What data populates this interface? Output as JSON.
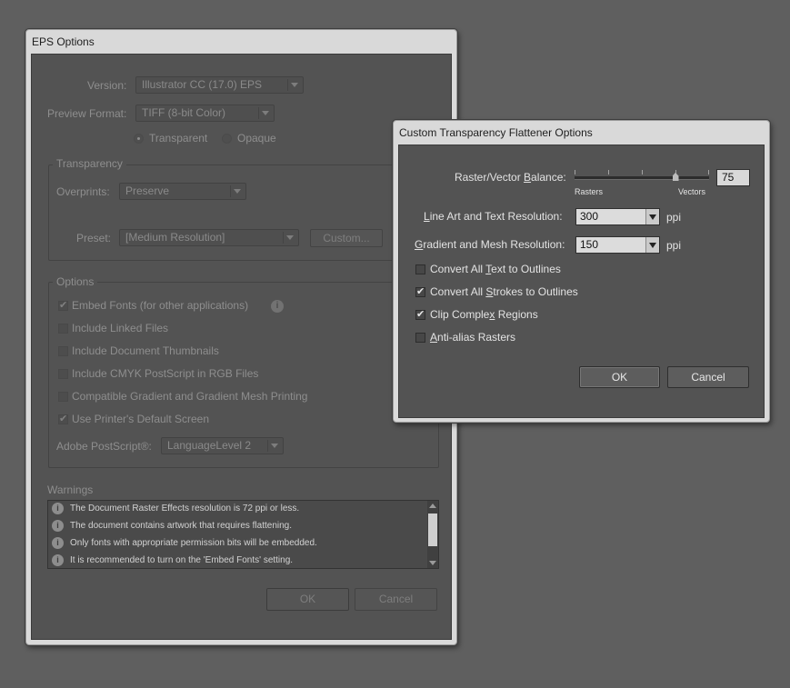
{
  "eps_dialog": {
    "title": "EPS Options",
    "version_label": "Version:",
    "version_value": "Illustrator CC (17.0) EPS",
    "preview_format_label": "Preview Format:",
    "preview_format_value": "TIFF (8-bit Color)",
    "radio_transparent": "Transparent",
    "radio_opaque": "Opaque",
    "transparency_group": "Transparency",
    "overprints_label": "Overprints:",
    "overprints_value": "Preserve",
    "preset_label": "Preset:",
    "preset_value": "[Medium Resolution]",
    "custom_button": "Custom...",
    "options_group": "Options",
    "checkboxes": [
      {
        "label": "Embed Fonts (for other applications)",
        "checked": true
      },
      {
        "label": "Include Linked Files",
        "checked": false
      },
      {
        "label": "Include Document Thumbnails",
        "checked": false
      },
      {
        "label": "Include CMYK PostScript in RGB Files",
        "checked": false
      },
      {
        "label": "Compatible Gradient and Gradient Mesh Printing",
        "checked": false
      },
      {
        "label": "Use Printer's Default Screen",
        "checked": true
      }
    ],
    "postscript_label": "Adobe PostScript®:",
    "postscript_value": "LanguageLevel 2",
    "warnings_label": "Warnings",
    "warnings": [
      "The Document Raster Effects resolution is 72 ppi or less.",
      "The document contains artwork that requires flattening.",
      "Only fonts with appropriate permission bits will be embedded.",
      "It is recommended to turn on the 'Embed Fonts' setting."
    ],
    "ok_button": "OK",
    "cancel_button": "Cancel"
  },
  "flattener_dialog": {
    "title": "Custom Transparency Flattener Options",
    "balance_label": "Raster/Vector Balance:",
    "balance_value": "75",
    "balance_fraction": 0.75,
    "rasters_label": "Rasters",
    "vectors_label": "Vectors",
    "line_art_label": "Line Art and Text Resolution:",
    "line_art_value": "300",
    "gradient_label": "Gradient and Mesh Resolution:",
    "gradient_value": "150",
    "ppi_unit": "ppi",
    "checkboxes": [
      {
        "label": "Convert All Text to Outlines",
        "checked": false
      },
      {
        "label": "Convert All Strokes to Outlines",
        "checked": true
      },
      {
        "label": "Clip Complex Regions",
        "checked": true
      },
      {
        "label": "Anti-alias Rasters",
        "checked": false
      }
    ],
    "ok_button": "OK",
    "cancel_button": "Cancel"
  }
}
